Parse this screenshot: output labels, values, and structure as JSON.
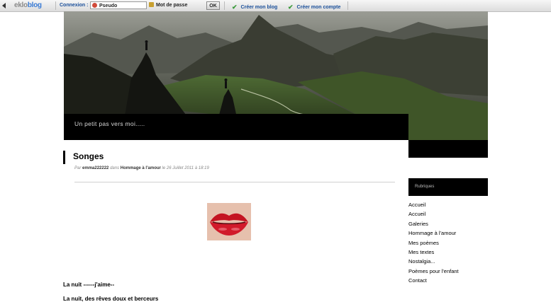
{
  "toolbar": {
    "logo_part1": "eklo",
    "logo_part2": "blog",
    "connexion_label": "Connexion :",
    "pseudo_placeholder": "Pseudo",
    "password_placeholder": "Mot de passe",
    "ok_label": "OK",
    "create_blog_label": "Créer mon blog",
    "create_account_label": "Créer mon compte"
  },
  "header": {
    "tagline": "Un petit pas vers moi....."
  },
  "post": {
    "title": "Songes",
    "meta_by": "Par",
    "author": "emma222222",
    "meta_in": "dans",
    "category": "Hommage à l'amour",
    "meta_date": "le 26 Juillet 2011 à 18:19",
    "poem_line1": "La nuit ------j'aime--",
    "poem_line2": "La nuit, des rêves doux et berceurs"
  },
  "sidebar": {
    "heading": "Rubriques",
    "items": [
      {
        "label": "Accueil"
      },
      {
        "label": "Accueil"
      },
      {
        "label": "Galeries"
      },
      {
        "label": "Hommage à l'amour"
      },
      {
        "label": "Mes poèmes"
      },
      {
        "label": "Mes textes"
      },
      {
        "label": "Nostalgia..."
      },
      {
        "label": "Poèmes pour l'enfant"
      },
      {
        "label": "Contact"
      }
    ]
  }
}
